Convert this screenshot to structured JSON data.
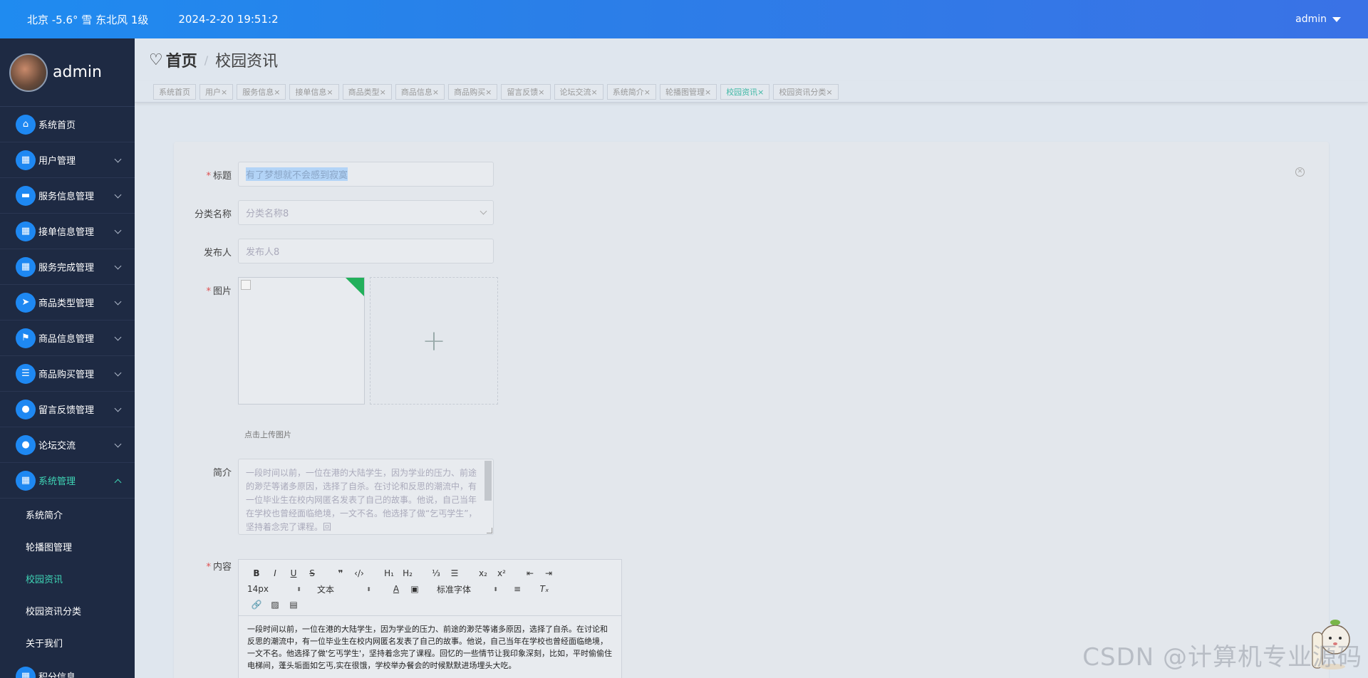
{
  "topbar": {
    "weather": "北京  -5.6°  雪  东北风  1级",
    "time": "2024-2-20 19:51:2",
    "user": "admin"
  },
  "sidebar": {
    "username": "admin",
    "menu": [
      {
        "label": "系统首页",
        "icon": "home-icon",
        "glyph": "⌂",
        "expandable": false
      },
      {
        "label": "用户管理",
        "icon": "grid-icon",
        "glyph": "▦",
        "expandable": true
      },
      {
        "label": "服务信息管理",
        "icon": "monitor-icon",
        "glyph": "▬",
        "expandable": true
      },
      {
        "label": "接单信息管理",
        "icon": "grid-icon",
        "glyph": "▦",
        "expandable": true
      },
      {
        "label": "服务完成管理",
        "icon": "grid-icon",
        "glyph": "▦",
        "expandable": true
      },
      {
        "label": "商品类型管理",
        "icon": "send-icon",
        "glyph": "➤",
        "expandable": true
      },
      {
        "label": "商品信息管理",
        "icon": "flag-icon",
        "glyph": "⚑",
        "expandable": true
      },
      {
        "label": "商品购买管理",
        "icon": "list-icon",
        "glyph": "☰",
        "expandable": true
      },
      {
        "label": "留言反馈管理",
        "icon": "user-icon",
        "glyph": "●",
        "expandable": true
      },
      {
        "label": "论坛交流",
        "icon": "location-icon",
        "glyph": "●",
        "expandable": true
      },
      {
        "label": "系统管理",
        "icon": "grid-icon",
        "glyph": "▦",
        "expandable": true
      }
    ],
    "submenu": [
      {
        "label": "系统简介"
      },
      {
        "label": "轮播图管理"
      },
      {
        "label": "校园资讯"
      },
      {
        "label": "校园资讯分类"
      },
      {
        "label": "关于我们"
      }
    ],
    "next_item": "积分信息"
  },
  "breadcrumb": {
    "home": "首页",
    "separator": "/",
    "current": "校园资讯"
  },
  "tags": [
    "系统首页",
    "用户×",
    "服务信息×",
    "接单信息×",
    "商品类型×",
    "商品信息×",
    "商品购买×",
    "留言反馈×",
    "论坛交流×",
    "系统简介×",
    "轮播图管理×",
    "校园资讯×",
    "校园资讯分类×"
  ],
  "form": {
    "title_label": "标题",
    "title_value": "有了梦想就不会感到寂寞",
    "category_label": "分类名称",
    "category_value": "分类名称8",
    "publisher_label": "发布人",
    "publisher_value": "发布人8",
    "image_label": "图片",
    "upload_plus": "+",
    "upload_hint": "点击上传图片",
    "intro_label": "简介",
    "intro_value": "一段时间以前，一位在港的大陆学生，因为学业的压力、前途的渺茫等诸多原因，选择了自杀。在讨论和反思的潮流中，有一位毕业生在校内网匿名发表了自己的故事。他说，自己当年在学校也曾经面临绝境，一文不名。他选择了做“乞丐学生”，坚持着念完了课程。回",
    "content_label": "内容",
    "editor": {
      "font_size": "14px",
      "heading": "文本",
      "font_family": "标准字体",
      "body": "一段时间以前，一位在港的大陆学生，因为学业的压力、前途的渺茫等诸多原因，选择了自杀。在讨论和反思的潮流中，有一位毕业生在校内网匿名发表了自己的故事。他说，自己当年在学校也曾经面临绝境，一文不名。他选择了做'乞丐学生'，坚持着念完了课程。回忆的一些情节让我印象深刻，比如，平时偷偷住电梯间，蓬头垢面如乞丐,实在很饿，学校举办餐会的时候默默进场埋头大吃。"
    }
  },
  "watermark": "CSDN @计算机专业源码"
}
